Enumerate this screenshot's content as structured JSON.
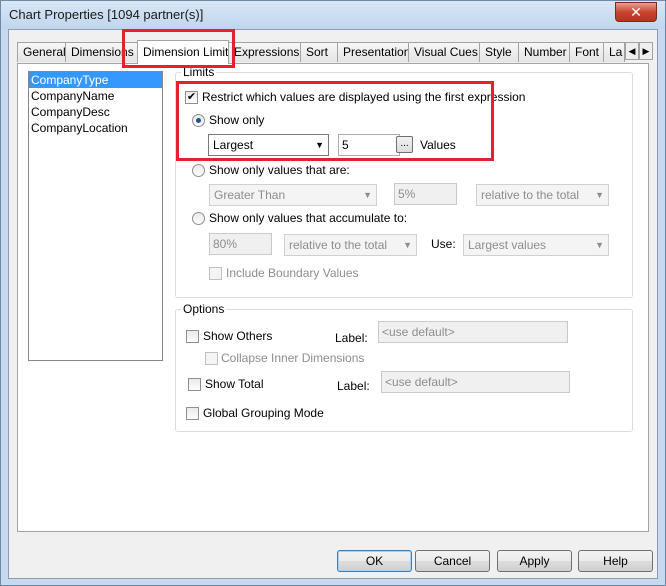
{
  "window": {
    "title": "Chart Properties [1094 partner(s)]",
    "close_label": "✕"
  },
  "tabs": [
    {
      "label": "General"
    },
    {
      "label": "Dimensions"
    },
    {
      "label": "Dimension Limits",
      "active": true
    },
    {
      "label": "Expressions"
    },
    {
      "label": "Sort"
    },
    {
      "label": "Presentation"
    },
    {
      "label": "Visual Cues"
    },
    {
      "label": "Style"
    },
    {
      "label": "Number"
    },
    {
      "label": "Font"
    },
    {
      "label": "La"
    }
  ],
  "tab_scroll": {
    "left": "◀",
    "right": "▶"
  },
  "dimensions": [
    "CompanyType",
    "CompanyName",
    "CompanyDesc",
    "CompanyLocation"
  ],
  "limits": {
    "legend": "Limits",
    "restrict_label": "Restrict which values are displayed using the first expression",
    "restrict_checked": true,
    "show_only_label": "Show only",
    "show_only_selected": true,
    "show_only_combo": "Largest",
    "show_only_count": "5",
    "browse_label": "...",
    "values_label": "Values",
    "values_are_label": "Show only values that are:",
    "values_are_combo": "Greater Than",
    "values_are_percent": "5%",
    "values_are_relative": "relative to the total",
    "accumulate_label": "Show only values that accumulate to:",
    "accumulate_percent": "80%",
    "accumulate_relative": "relative to the total",
    "use_label": "Use:",
    "use_combo": "Largest values",
    "include_boundary_label": "Include Boundary Values"
  },
  "options": {
    "legend": "Options",
    "show_others_label": "Show Others",
    "label_caption": "Label:",
    "show_others_placeholder": "<use default>",
    "collapse_label": "Collapse Inner Dimensions",
    "show_total_label": "Show Total",
    "show_total_placeholder": "<use default>",
    "global_grouping_label": "Global Grouping Mode"
  },
  "buttons": {
    "ok": "OK",
    "cancel": "Cancel",
    "apply": "Apply",
    "help": "Help"
  },
  "colors": {
    "highlight": "#e3222c",
    "selection": "#3399ff"
  }
}
